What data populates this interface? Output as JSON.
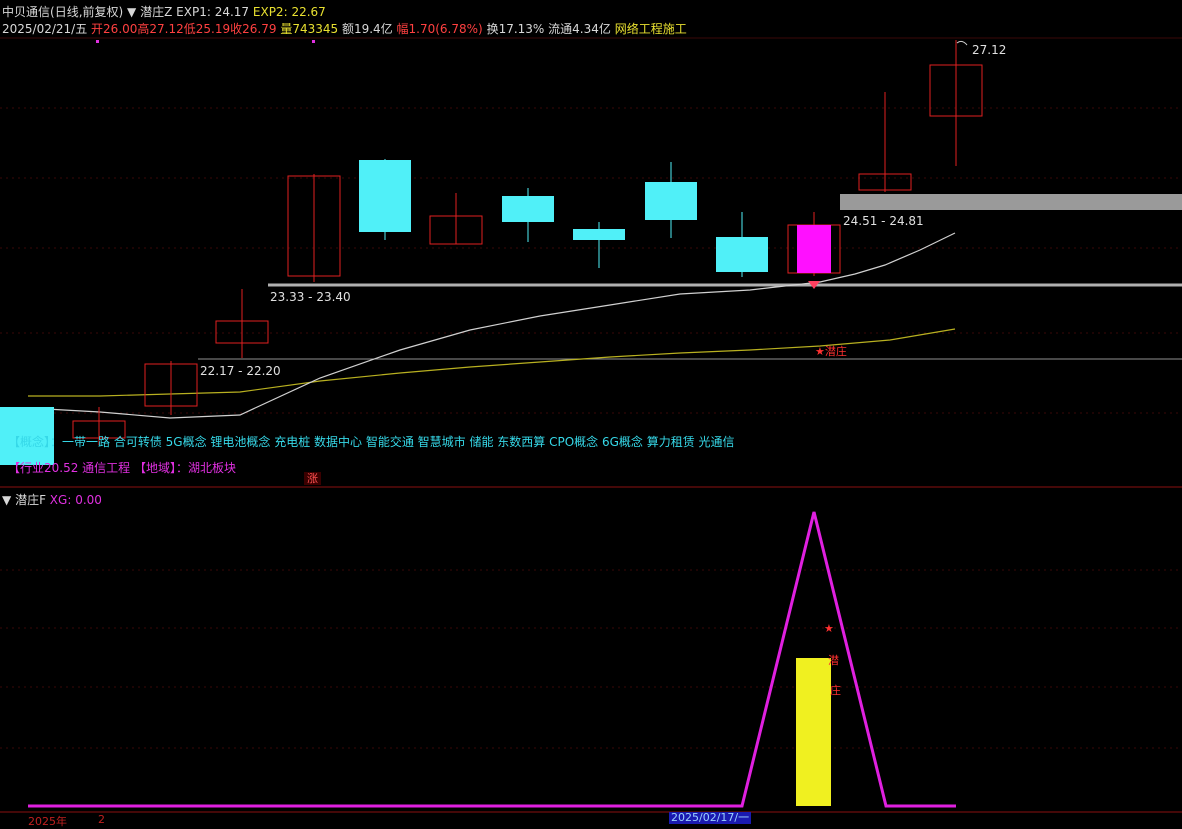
{
  "header": {
    "stock_name": "中贝通信",
    "period_mode": "(日线,前复权)",
    "indicator_name": "潜庄Z",
    "exp1_label": "EXP1:",
    "exp1_value": "24.17",
    "exp2_label": "EXP2:",
    "exp2_value": "22.67",
    "date": "2025/02/21/五",
    "open": "开26.00",
    "high": "高27.12",
    "low": "低25.19",
    "close": "收26.79",
    "volume": "量743345",
    "amount": "额19.4亿",
    "change": "幅1.70(6.78%)",
    "turnover": "换17.13%",
    "float_cap": "流通4.34亿",
    "industry": "网络工程施工"
  },
  "price_labels": {
    "high_marker": "27.12",
    "zone_top": "24.51 - 24.81",
    "zone_mid": "23.33 - 23.40",
    "zone_low": "22.17 - 22.20"
  },
  "annotations": {
    "main_star": "★潜庄",
    "sub_star": "★",
    "sub_char1": "潜",
    "sub_char2": "庄",
    "zhang_badge": "涨"
  },
  "concepts": {
    "text": "【概念】：一带一路 合可转债 5G概念 锂电池概念 充电桩 数据中心 智能交通 智慧城市 储能 东数西算 CPO概念 6G概念 算力租赁 光通信"
  },
  "region_info": {
    "text": "【行业20.52 通信工程 【地域】：湖北板块"
  },
  "sub_indicator": {
    "name": "潜庄F",
    "xg_label": "XG:",
    "xg_value": "0.00"
  },
  "axis": {
    "year_label": "2025年",
    "month_label": "2",
    "cursor_date": "2025/02/17/一"
  },
  "colors": {
    "background": "#000000",
    "up_candle": "#e02020",
    "down_candle": "#50f0f8",
    "signal_candle": "#ff10ff",
    "ma_fast": "#d0d0d0",
    "ma_slow": "#b8b020",
    "zone_bar": "#9a9a9a",
    "sub_line": "#e020e0",
    "sub_bar": "#f0f020"
  }
}
